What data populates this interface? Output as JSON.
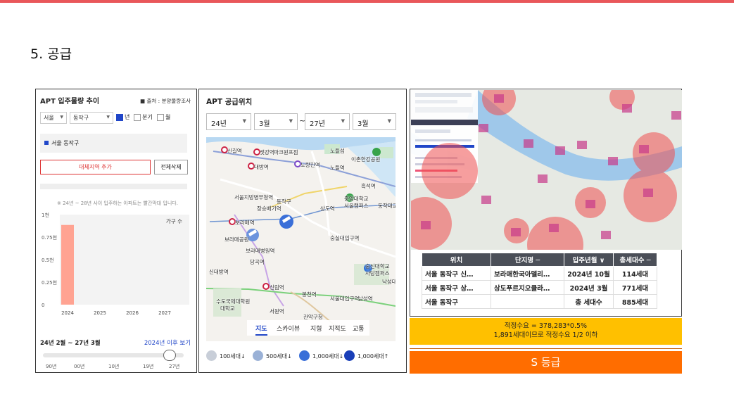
{
  "section_title": "5. 공급",
  "panel1": {
    "title": "APT 입주물량 추이",
    "source": "■ 출처 : 분양물량조사",
    "city_select": "서울",
    "district_select": "동작구",
    "period_options": [
      "년",
      "분기",
      "월"
    ],
    "period_selected": "년",
    "region_label": "서울 동작구",
    "add_region_label": "대체지역 추가",
    "delete_all_label": "전체삭제",
    "note": "※ 24년 ~ 28년 사이 입주하는 아파트는 빨간막대 입니다.",
    "period_label": "24년 2월 ~ 27년 3월",
    "after_label": "2024년 이후 보기",
    "slider_ticks": [
      "90년",
      "00년",
      "10년",
      "19년",
      "27년"
    ]
  },
  "chart_data": {
    "type": "bar",
    "categories": [
      "2024",
      "2025",
      "2026",
      "2027"
    ],
    "series": [
      {
        "name": "가구 수",
        "values": [
          885,
          0,
          0,
          0
        ],
        "color": "#ffa392"
      }
    ],
    "ytick_labels": [
      "0",
      "0.25천",
      "0.5천",
      "0.75천",
      "1천"
    ],
    "ylim": [
      0,
      1000
    ]
  },
  "panel2": {
    "title": "APT 공급위치",
    "start_year": "24년",
    "start_month": "3월",
    "end_year": "27년",
    "end_month": "3월",
    "tilde": "~",
    "map_labels": [
      "신길역",
      "샛강역",
      "파크원프점",
      "노들섬",
      "이촌한강공원",
      "대방역",
      "노량진역",
      "노들역",
      "흑석역",
      "서울지방병무청역",
      "동작구",
      "장승배기역",
      "상도역",
      "중앙대학교",
      "서울캠퍼스",
      "동작대교",
      "보라매역",
      "보라매공원",
      "보라매병원역",
      "숭실대입구역",
      "당곡역",
      "신대방역",
      "숭신대학교",
      "사당캠퍼스",
      "신림역",
      "봉천역",
      "서울대입구역",
      "남성역",
      "낙성대",
      "수도국제대학원",
      "대학교",
      "서원역",
      "관악구청"
    ],
    "map_tabs": [
      "지도",
      "스카이뷰",
      "지형",
      "지적도",
      "교통"
    ],
    "map_tab_active": "지도",
    "legend": [
      "100세대↓",
      "500세대↓",
      "1,000세대↓",
      "1,000세대↑"
    ],
    "colors": {
      "pin_light": "#9ab1d6",
      "pin_mid": "#6b93dd",
      "pin_dark": "#3a6fd8",
      "pin_darkest": "#1a3fb8"
    }
  },
  "panel3": {
    "table_headers": [
      "위치",
      "단지명 ─",
      "입주년월 ∨",
      "총세대수 ─"
    ],
    "rows": [
      [
        "서울 동작구 신…",
        "보라매한국아델리…",
        "2024년 10월",
        "114세대"
      ],
      [
        "서울 동작구 상…",
        "상도푸르지오클라…",
        "2024년 3월",
        "771세대"
      ],
      [
        "서울 동작구",
        "",
        "총 세대수",
        "885세대"
      ]
    ]
  },
  "demand_line1": "적정수요 = 378,283*0.5%",
  "demand_line2": "1,891세대이므로 적정수요 1/2 이하",
  "grade": "S 등급",
  "colors": {
    "top_bar": "#e9575a",
    "demand_bg": "#ffc000",
    "grade_bg": "#ff6d00",
    "accent_blue": "#2046c8"
  }
}
